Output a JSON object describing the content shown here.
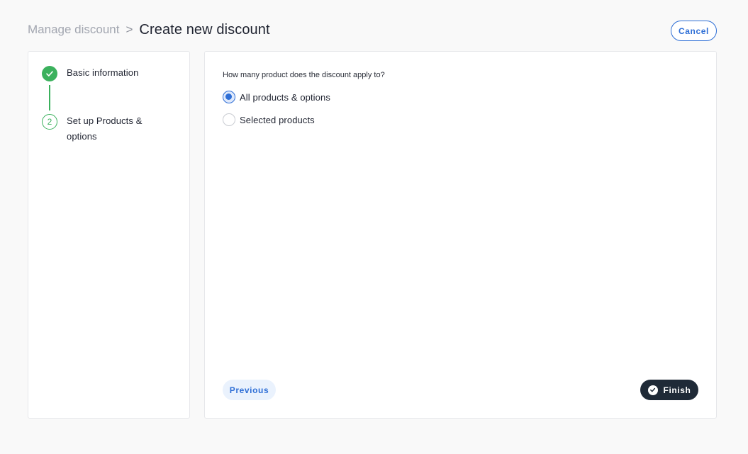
{
  "header": {
    "breadcrumb_parent": "Manage discount",
    "breadcrumb_separator": ">",
    "title": "Create new discount",
    "cancel_label": "Cancel"
  },
  "steps": [
    {
      "number": "1",
      "label": "Basic information",
      "status": "complete",
      "icon": "check-icon"
    },
    {
      "number": "2",
      "label": "Set up Products & options",
      "status": "current"
    }
  ],
  "form": {
    "question": "How many product does the discount apply to?",
    "options": [
      {
        "label": "All products & options",
        "selected": true
      },
      {
        "label": "Selected products",
        "selected": false
      }
    ]
  },
  "footer": {
    "previous_label": "Previous",
    "finish_label": "Finish",
    "finish_icon": "check-circle-icon"
  },
  "colors": {
    "accent_blue": "#2f6fd6",
    "success_green": "#3bb15d",
    "dark_button": "#1f2a37",
    "background": "#f9f9f9"
  }
}
